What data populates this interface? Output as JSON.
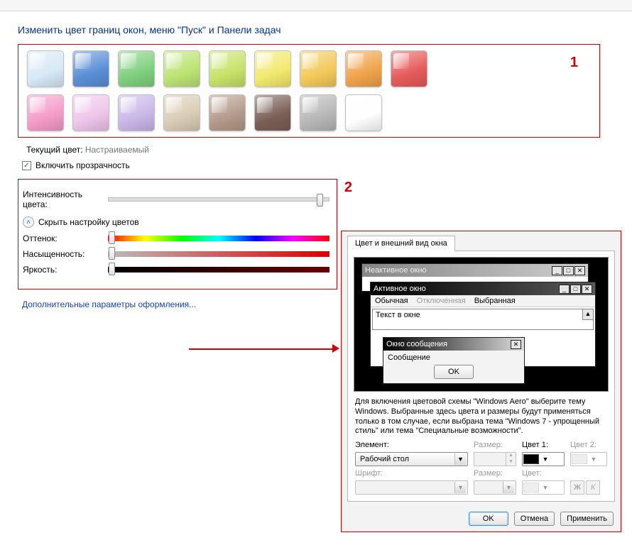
{
  "title": "Изменить цвет границ окон, меню \"Пуск\" и Панели задач",
  "annotations": {
    "one": "1",
    "two": "2"
  },
  "swatches_row1": [
    "#d7e9f7",
    "#5a8fd6",
    "#7fd07f",
    "#bde374",
    "#c8e26a",
    "#f2e96f",
    "#f3c95a",
    "#f0a34b",
    "#e65b5b"
  ],
  "swatches_row2": [
    "#f49cc8",
    "#eec5ea",
    "#c9b7e8",
    "#d8cdb4",
    "#b39a8a",
    "#7a5f56",
    "#b7b7b7",
    "#fefefe"
  ],
  "current_color": {
    "label": "Текущий цвет:",
    "value": "Настраиваемый"
  },
  "transparency": {
    "checked": true,
    "label": "Включить прозрачность"
  },
  "intensity": {
    "label": "Интенсивность цвета:",
    "pos": 96
  },
  "collapse": {
    "label": "Скрыть настройку цветов"
  },
  "hue": {
    "label": "Оттенок:",
    "pos": 2
  },
  "saturation": {
    "label": "Насыщенность:",
    "pos": 2
  },
  "brightness": {
    "label": "Яркость:",
    "pos": 2
  },
  "adv_link": "Дополнительные параметры оформления...",
  "dialog": {
    "tab": "Цвет и внешний вид окна",
    "inactive_title": "Неактивное окно",
    "active_title": "Активное окно",
    "menu": {
      "normal": "Обычная",
      "disabled": "Отключенная",
      "selected": "Выбранная"
    },
    "text_in_window": "Текст в окне",
    "msg_title": "Окно сообщения",
    "msg_body": "Сообщение",
    "ok": "OK",
    "helptext": "Для включения цветовой схемы \"Windows Aero\" выберите тему Windows.  Выбранные здесь цвета и размеры будут применяться только в том случае, если выбрана тема \"Windows 7 - упрощенный стиль\" или тема \"Специальные возможности\".",
    "labels": {
      "element": "Элемент:",
      "size": "Размер:",
      "color1": "Цвет 1:",
      "color2": "Цвет 2:",
      "font": "Шрифт:",
      "fsize": "Размер:",
      "fcolor": "Цвет:"
    },
    "element_value": "Рабочий стол",
    "color1_value": "#000000",
    "style_bold": "Ж",
    "style_italic": "К",
    "buttons": {
      "ok": "OK",
      "cancel": "Отмена",
      "apply": "Применить"
    }
  }
}
